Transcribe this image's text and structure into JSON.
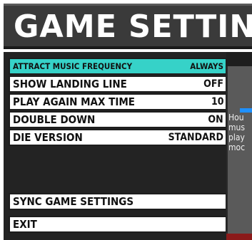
{
  "header": {
    "title": "GAME SETTINGS"
  },
  "menu": {
    "items": [
      {
        "label": "ATTRACT MUSIC FREQUENCY",
        "value": "ALWAYS"
      },
      {
        "label": "SHOW LANDING LINE",
        "value": "OFF"
      },
      {
        "label": "PLAY AGAIN MAX TIME",
        "value": "10"
      },
      {
        "label": "DOUBLE DOWN",
        "value": "ON"
      },
      {
        "label": "DIE VERSION",
        "value": "STANDARD"
      }
    ],
    "actions": [
      {
        "label": "SYNC GAME SETTINGS"
      },
      {
        "label": "EXIT"
      }
    ]
  },
  "preview": {
    "lines": [
      "Hou",
      "mus",
      "play",
      "moc"
    ]
  },
  "colors": {
    "selected_highlight": "#36d2c8",
    "header_bg": "#3a3a3a",
    "panel_bg": "#232323",
    "accent_blue": "#1e90ff",
    "footer_red": "#8b1a1a"
  }
}
